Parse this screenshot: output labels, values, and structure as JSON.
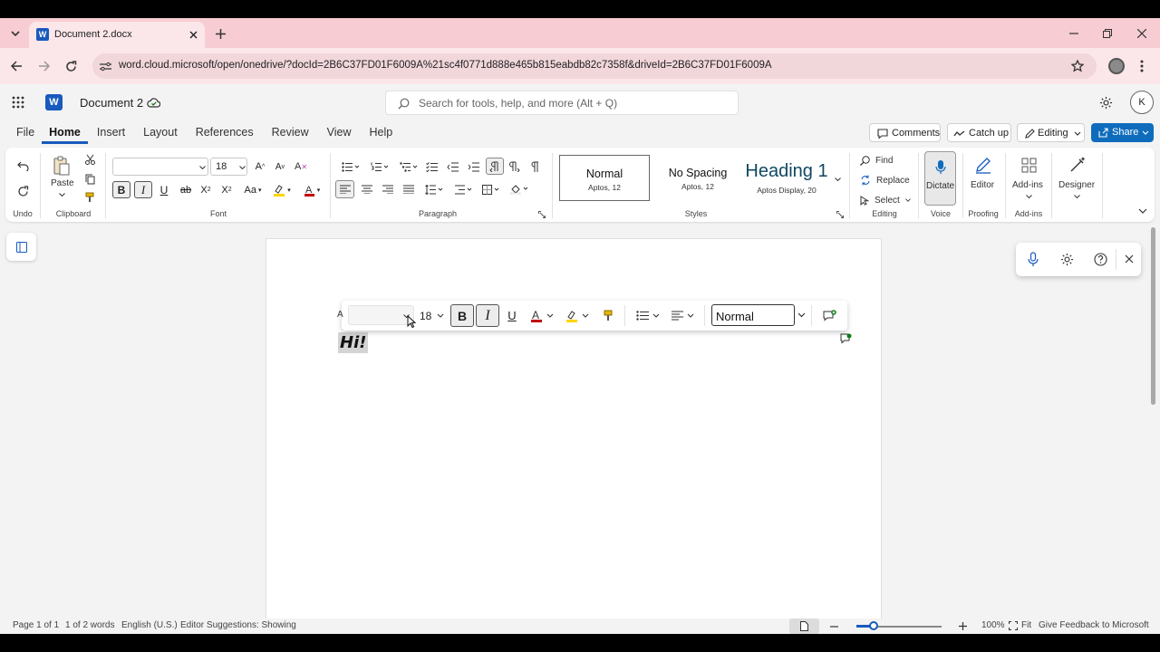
{
  "browser": {
    "tab_title": "Document 2.docx",
    "url": "word.cloud.microsoft/open/onedrive/?docId=2B6C37FD01F6009A%21sc4f0771d888e465b815eabdb82c7358f&driveId=2B6C37FD01F6009A"
  },
  "word": {
    "doc_title": "Document 2",
    "search_placeholder": "Search for tools, help, and more (Alt + Q)",
    "avatar_initial": "K",
    "menu": [
      "File",
      "Home",
      "Insert",
      "Layout",
      "References",
      "Review",
      "View",
      "Help"
    ],
    "active_menu": "Home",
    "actions": {
      "comments": "Comments",
      "catch_up": "Catch up",
      "editing": "Editing",
      "share": "Share"
    }
  },
  "ribbon": {
    "undo_label": "Undo",
    "clipboard": {
      "paste": "Paste",
      "label": "Clipboard"
    },
    "font": {
      "name_value": "",
      "size_value": "18",
      "label": "Font"
    },
    "paragraph_label": "Paragraph",
    "styles": {
      "label": "Styles",
      "items": [
        {
          "name": "Normal",
          "sub": "Aptos, 12"
        },
        {
          "name": "No Spacing",
          "sub": "Aptos, 12"
        },
        {
          "name": "Heading 1",
          "sub": "Aptos Display, 20"
        }
      ]
    },
    "editing": {
      "find": "Find",
      "replace": "Replace",
      "select": "Select",
      "label": "Editing"
    },
    "voice": {
      "dictate": "Dictate",
      "label": "Voice"
    },
    "proofing": {
      "editor": "Editor",
      "label": "Proofing"
    },
    "addins": {
      "addins": "Add-ins",
      "label": "Add-ins"
    },
    "designer": {
      "designer": "Designer"
    }
  },
  "floating_toolbar": {
    "font_value": "",
    "size_value": "18",
    "style_value": "Normal"
  },
  "document": {
    "text": "Hi!"
  },
  "status": {
    "page": "Page 1 of 1",
    "words": "1 of 2 words",
    "language": "English (U.S.)",
    "editor": "Editor Suggestions: Showing",
    "zoom": "100%",
    "fit": "Fit",
    "feedback": "Give Feedback to Microsoft",
    "zoom_level_fraction": 0.2
  },
  "colors": {
    "word_blue": "#185abd",
    "share_blue": "#0f6cbd",
    "tab_pink": "#f7cdd3",
    "font_color_red": "#c00000",
    "highlight_yellow": "#ffd400",
    "selection_gray": "#d4d4d4"
  }
}
